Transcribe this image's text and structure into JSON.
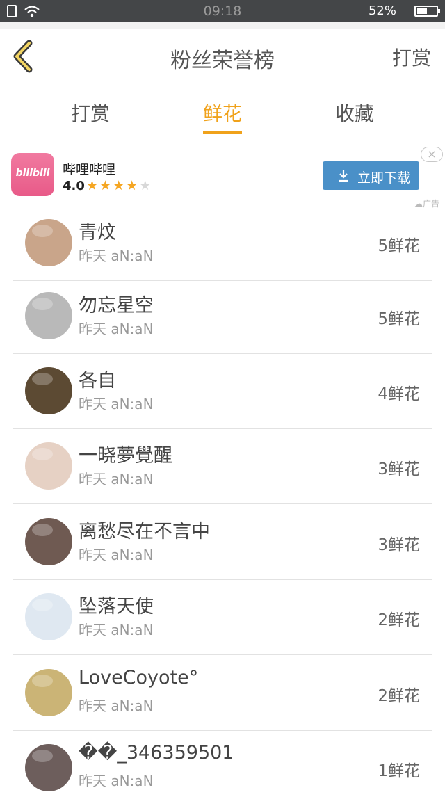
{
  "status_bar": {
    "time": "09:18",
    "battery": "52%",
    "battery_level": 0.52
  },
  "header": {
    "title": "粉丝荣誉榜",
    "right_action": "打赏"
  },
  "tabs": [
    {
      "label": "打赏",
      "active": false
    },
    {
      "label": "鲜花",
      "active": true
    },
    {
      "label": "收藏",
      "active": false
    }
  ],
  "ad": {
    "logo_text": "bilibili",
    "name": "哔哩哔哩",
    "rating": "4.0",
    "stars": 4,
    "button_label": "立即下载",
    "tag": "广告",
    "close_glyph": "×"
  },
  "colors": {
    "accent": "#f0a21b",
    "ad_button": "#4a90c8"
  },
  "fans": [
    {
      "name": "青炆",
      "time": "昨天 aN:aN",
      "count": "5鲜花",
      "avatar": "#c9a58a"
    },
    {
      "name": "勿忘星空",
      "time": "昨天 aN:aN",
      "count": "5鲜花",
      "avatar": "#b9b9b9"
    },
    {
      "name": "各自",
      "time": "昨天 aN:aN",
      "count": "4鲜花",
      "avatar": "#5c4a33"
    },
    {
      "name": "一晓夢覺醒",
      "time": "昨天 aN:aN",
      "count": "3鲜花",
      "avatar": "#e6d1c4"
    },
    {
      "name": "离愁尽在不言中",
      "time": "昨天 aN:aN",
      "count": "3鲜花",
      "avatar": "#6f5a52"
    },
    {
      "name": "坠落天使",
      "time": "昨天 aN:aN",
      "count": "2鲜花",
      "avatar": "#dfe8f1"
    },
    {
      "name": "LoveCoyote°",
      "time": "昨天 aN:aN",
      "count": "2鲜花",
      "avatar": "#cbb476"
    },
    {
      "name": "��_346359501",
      "time": "昨天 aN:aN",
      "count": "1鲜花",
      "avatar": "#6d5e5c"
    }
  ]
}
